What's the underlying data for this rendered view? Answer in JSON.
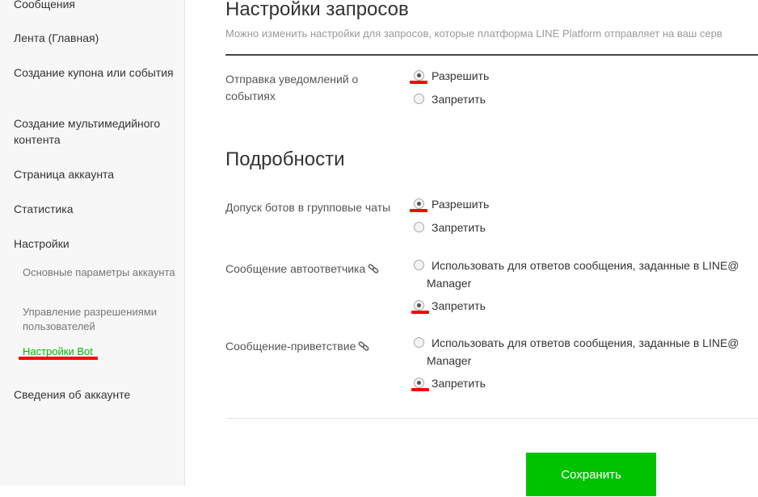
{
  "sidebar": {
    "items": [
      {
        "label": "Сообщения"
      },
      {
        "label": "Лента (Главная)"
      },
      {
        "label": "Создание купона или события"
      },
      {
        "label": "Создание мультимедийного контента"
      },
      {
        "label": "Страница аккаунта"
      },
      {
        "label": "Статистика"
      },
      {
        "label": "Настройки"
      }
    ],
    "sub_items": [
      {
        "label": "Основные параметры аккаунта"
      },
      {
        "label": "Управление разрешениями пользователей"
      },
      {
        "label": "Настройки Bot",
        "active": true
      }
    ],
    "bottom_item": {
      "label": "Сведения об аккаунте"
    }
  },
  "requests": {
    "title": "Настройки запросов",
    "description": "Можно изменить настройки для запросов, которые платформа LINE Platform отправляет на ваш серв",
    "event_notifications": {
      "label": "Отправка уведомлений о событиях",
      "options": [
        "Разрешить",
        "Запретить"
      ],
      "selected": "Разрешить"
    }
  },
  "details": {
    "title": "Подробности",
    "group_chats": {
      "label": "Допуск ботов в групповые чаты",
      "options": [
        "Разрешить",
        "Запретить"
      ],
      "selected": "Разрешить"
    },
    "auto_reply": {
      "label": "Сообщение автоответчика",
      "options": [
        "Использовать для ответов сообщения, заданные в LINE@ Manager",
        "Запретить"
      ],
      "selected": "Запретить"
    },
    "greeting": {
      "label": "Сообщение-приветствие",
      "options": [
        "Использовать для ответов сообщения, заданные в LINE@ Manager",
        "Запретить"
      ],
      "selected": "Запретить"
    }
  },
  "actions": {
    "save_label": "Сохранить"
  },
  "colors": {
    "accent": "#00c300",
    "annotation": "#ff0000"
  },
  "icons": {
    "link": "link-icon"
  }
}
